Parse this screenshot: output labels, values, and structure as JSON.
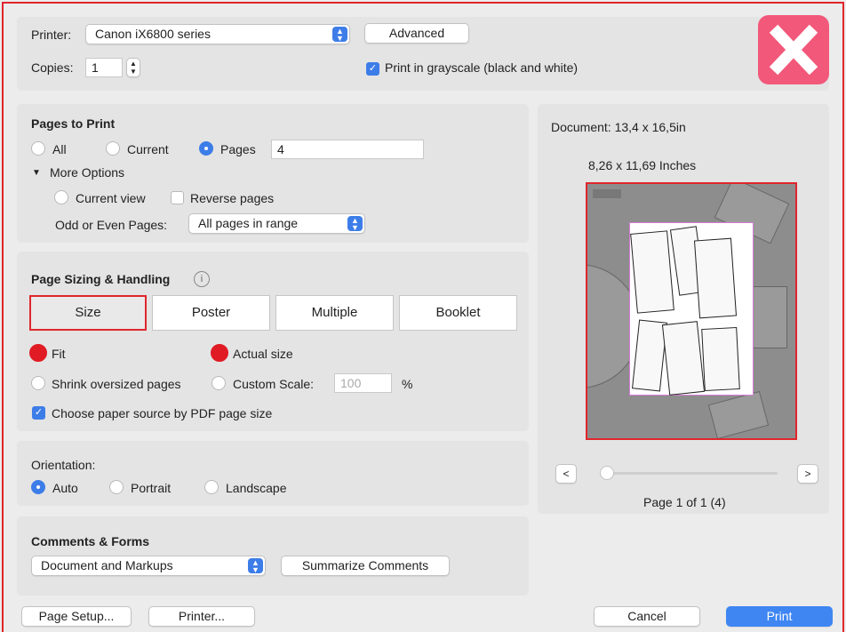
{
  "printer": {
    "label": "Printer:",
    "value": "Canon iX6800 series",
    "advanced_label": "Advanced"
  },
  "copies": {
    "label": "Copies:",
    "value": "1"
  },
  "grayscale": {
    "label": "Print in grayscale (black and white)",
    "checked": true
  },
  "pages_to_print": {
    "title": "Pages to Print",
    "all": "All",
    "current": "Current",
    "pages": "Pages",
    "pages_value": "4",
    "more_options": "More Options",
    "current_view": "Current view",
    "reverse_pages": "Reverse pages",
    "odd_even_label": "Odd or Even Pages:",
    "odd_even_value": "All pages in range"
  },
  "sizing": {
    "title": "Page Sizing & Handling",
    "tabs": [
      "Size",
      "Poster",
      "Multiple",
      "Booklet"
    ],
    "fit": "Fit",
    "actual_size": "Actual size",
    "shrink": "Shrink oversized pages",
    "custom_scale": "Custom Scale:",
    "scale_placeholder": "100",
    "percent": "%",
    "paper_source": "Choose paper source by PDF page size"
  },
  "orientation": {
    "title": "Orientation:",
    "auto": "Auto",
    "portrait": "Portrait",
    "landscape": "Landscape"
  },
  "comments": {
    "title": "Comments & Forms",
    "value": "Document and Markups",
    "summarize": "Summarize Comments"
  },
  "preview": {
    "document_size": "Document: 13,4 x 16,5in",
    "paper_size": "8,26 x 11,69 Inches",
    "prev": "<",
    "next": ">",
    "page_info": "Page 1 of 1 (4)",
    "page_fraction": 0
  },
  "footer": {
    "page_setup": "Page Setup...",
    "printer": "Printer...",
    "cancel": "Cancel",
    "print": "Print"
  },
  "colors": {
    "accent": "#3d7de8",
    "highlight": "#e01b24",
    "close": "#f2587a"
  },
  "icons": {
    "close": "close-icon",
    "info": "info-icon",
    "triangle": "disclosure-triangle-icon"
  }
}
